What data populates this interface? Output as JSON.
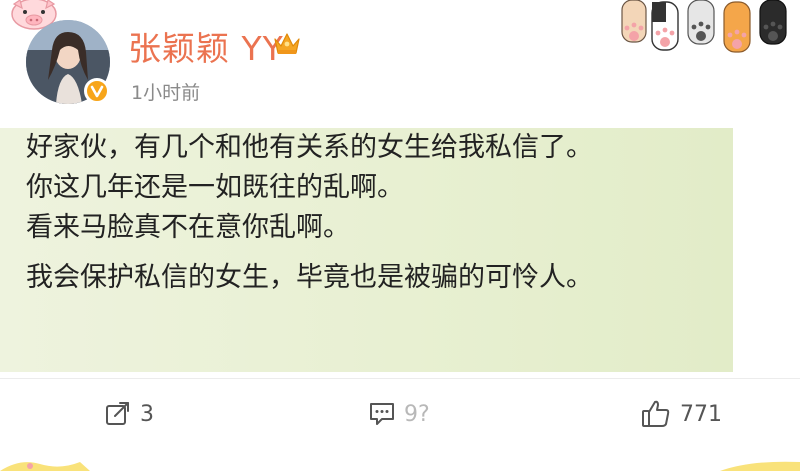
{
  "post": {
    "username": "张颖颖 YY",
    "timestamp": "1小时前",
    "lines": [
      "好家伙，有几个和他有关系的女生给我私信了。",
      "你这几年还是一如既往的乱啊。",
      "看来马脸真不在意你乱啊。",
      "我会保护私信的女生，毕竟也是被骗的可怜人。"
    ]
  },
  "actions": {
    "repost_count": "3",
    "comment_count": "9?",
    "like_count": "771"
  },
  "colors": {
    "username": "#eb7350",
    "verified_badge": "#f7a51a",
    "highlight": "#e8f0d2"
  },
  "icons": {
    "verified": "verified-v-icon",
    "member": "member-crown-icon",
    "repost": "repost-icon",
    "comment": "comment-icon",
    "like": "thumbs-up-icon"
  }
}
